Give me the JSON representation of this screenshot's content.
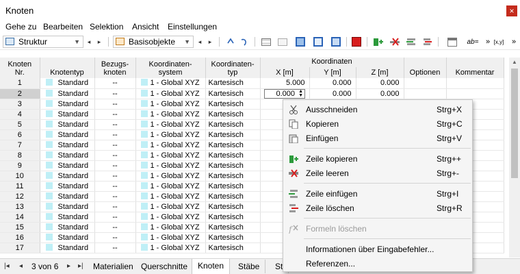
{
  "window": {
    "title": "Knoten",
    "close_glyph": "×"
  },
  "menu": [
    "Gehe zu",
    "Bearbeiten",
    "Selektion",
    "Ansicht",
    "Einstellungen"
  ],
  "toolbar": {
    "combo1": "Struktur",
    "combo2": "Basisobjekte",
    "prev": "◂",
    "next": "▸",
    "overflow": "»"
  },
  "table": {
    "group_header": "Koordinaten",
    "headers": [
      "Knoten\nNr.",
      "Knotentyp",
      "Bezugs-\nknoten",
      "Koordinaten-\nsystem",
      "Koordinaten-\ntyp",
      "X [m]",
      "Y [m]",
      "Z [m]",
      "Optionen",
      "Kommentar"
    ],
    "rows": [
      {
        "nr": "1",
        "typ": "Standard",
        "bezug": "--",
        "sys": "1 - Global XYZ",
        "ktyp": "Kartesisch",
        "x": "5.000",
        "y": "0.000",
        "z": "0.000"
      },
      {
        "nr": "2",
        "typ": "Standard",
        "bezug": "--",
        "sys": "1 - Global XYZ",
        "ktyp": "Kartesisch",
        "x": "0.000",
        "y": "0.000",
        "z": "0.000"
      },
      {
        "nr": "3",
        "typ": "Standard",
        "bezug": "--",
        "sys": "1 - Global XYZ",
        "ktyp": "Kartesisch",
        "x": "",
        "y": "",
        "z": ""
      },
      {
        "nr": "4",
        "typ": "Standard",
        "bezug": "--",
        "sys": "1 - Global XYZ",
        "ktyp": "Kartesisch",
        "x": "",
        "y": "",
        "z": ""
      },
      {
        "nr": "5",
        "typ": "Standard",
        "bezug": "--",
        "sys": "1 - Global XYZ",
        "ktyp": "Kartesisch",
        "x": "",
        "y": "",
        "z": ""
      },
      {
        "nr": "6",
        "typ": "Standard",
        "bezug": "--",
        "sys": "1 - Global XYZ",
        "ktyp": "Kartesisch",
        "x": "",
        "y": "",
        "z": ""
      },
      {
        "nr": "7",
        "typ": "Standard",
        "bezug": "--",
        "sys": "1 - Global XYZ",
        "ktyp": "Kartesisch",
        "x": "",
        "y": "",
        "z": ""
      },
      {
        "nr": "8",
        "typ": "Standard",
        "bezug": "--",
        "sys": "1 - Global XYZ",
        "ktyp": "Kartesisch",
        "x": "",
        "y": "",
        "z": ""
      },
      {
        "nr": "9",
        "typ": "Standard",
        "bezug": "--",
        "sys": "1 - Global XYZ",
        "ktyp": "Kartesisch",
        "x": "",
        "y": "",
        "z": ""
      },
      {
        "nr": "10",
        "typ": "Standard",
        "bezug": "--",
        "sys": "1 - Global XYZ",
        "ktyp": "Kartesisch",
        "x": "",
        "y": "",
        "z": ""
      },
      {
        "nr": "11",
        "typ": "Standard",
        "bezug": "--",
        "sys": "1 - Global XYZ",
        "ktyp": "Kartesisch",
        "x": "",
        "y": "",
        "z": ""
      },
      {
        "nr": "12",
        "typ": "Standard",
        "bezug": "--",
        "sys": "1 - Global XYZ",
        "ktyp": "Kartesisch",
        "x": "",
        "y": "",
        "z": ""
      },
      {
        "nr": "13",
        "typ": "Standard",
        "bezug": "--",
        "sys": "1 - Global XYZ",
        "ktyp": "Kartesisch",
        "x": "",
        "y": "",
        "z": ""
      },
      {
        "nr": "14",
        "typ": "Standard",
        "bezug": "--",
        "sys": "1 - Global XYZ",
        "ktyp": "Kartesisch",
        "x": "",
        "y": "",
        "z": ""
      },
      {
        "nr": "15",
        "typ": "Standard",
        "bezug": "--",
        "sys": "1 - Global XYZ",
        "ktyp": "Kartesisch",
        "x": "",
        "y": "",
        "z": ""
      },
      {
        "nr": "16",
        "typ": "Standard",
        "bezug": "--",
        "sys": "1 - Global XYZ",
        "ktyp": "Kartesisch",
        "x": "",
        "y": "",
        "z": ""
      },
      {
        "nr": "17",
        "typ": "Standard",
        "bezug": "--",
        "sys": "1 - Global XYZ",
        "ktyp": "Kartesisch",
        "x": "",
        "y": "",
        "z": ""
      }
    ],
    "selected_row": "2"
  },
  "tabs": {
    "first": "|◂",
    "prev": "◂",
    "page": "3 von 6",
    "next": "▸",
    "last": "▸|",
    "items": [
      "Materialien",
      "Querschnitte",
      "Knoten",
      "Stäbe",
      "St"
    ],
    "active": "Knoten"
  },
  "context_menu": [
    {
      "label": "Ausschneiden",
      "shortcut": "Strg+X",
      "icon": "scissors-icon"
    },
    {
      "label": "Kopieren",
      "shortcut": "Strg+C",
      "icon": "copy-icon"
    },
    {
      "label": "Einfügen",
      "shortcut": "Strg+V",
      "icon": "paste-icon"
    },
    {
      "label": "Zeile kopieren",
      "shortcut": "Strg++",
      "icon": "copy-row-icon"
    },
    {
      "label": "Zeile leeren",
      "shortcut": "Strg+-",
      "icon": "clear-row-icon"
    },
    {
      "label": "Zeile einfügen",
      "shortcut": "Strg+I",
      "icon": "insert-row-icon"
    },
    {
      "label": "Zeile löschen",
      "shortcut": "Strg+R",
      "icon": "delete-row-icon"
    },
    {
      "label": "Formeln löschen",
      "shortcut": "",
      "icon": "formula-delete-icon",
      "disabled": true
    },
    {
      "label": "Informationen über Eingabefehler...",
      "shortcut": "",
      "icon": ""
    },
    {
      "label": "Referenzen...",
      "shortcut": "",
      "icon": ""
    }
  ],
  "colors": {
    "accent_cell": "#bfeff6",
    "close": "#c42b1c",
    "selected_header": "#d0d0d0"
  }
}
